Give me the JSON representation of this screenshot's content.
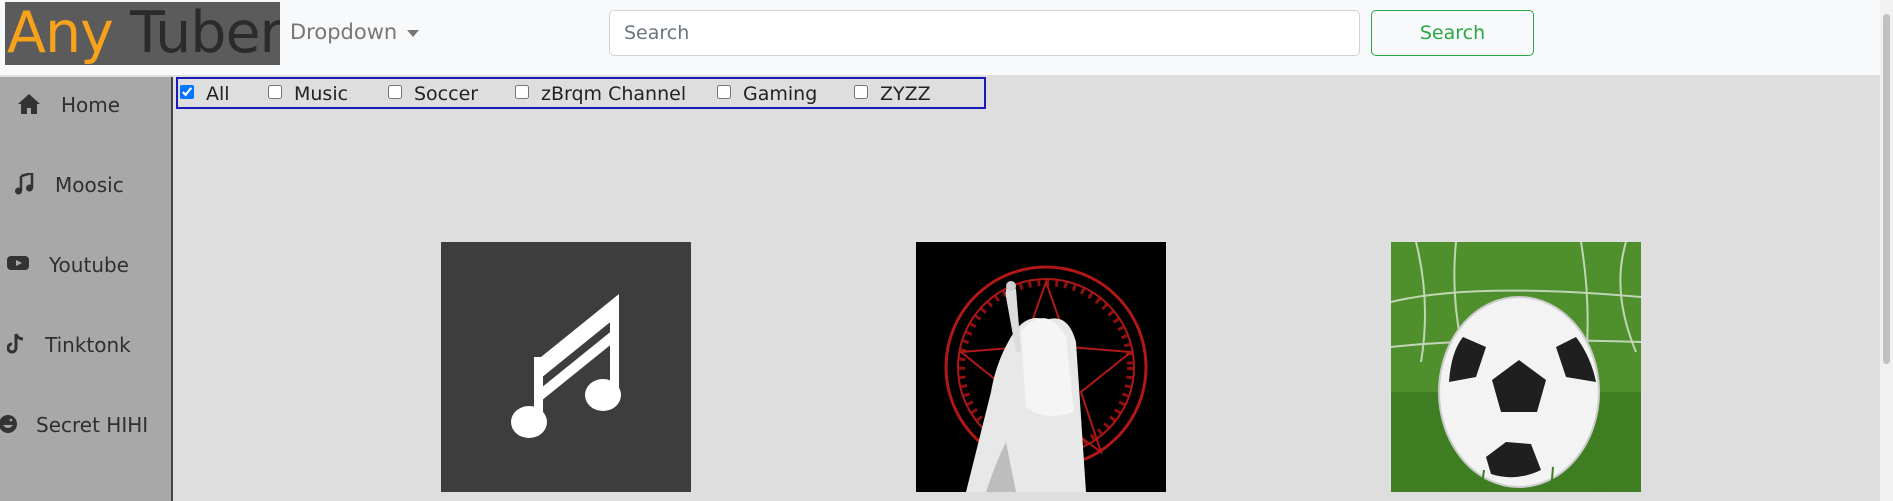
{
  "brand": {
    "part1": "Any",
    "part2": "Tubers",
    "accent": "#f7a21b"
  },
  "navbar": {
    "dropdown_label": "Dropdown",
    "search_placeholder": "Search",
    "search_button": "Search"
  },
  "sidebar": {
    "items": [
      {
        "label": "Home",
        "icon": "home-icon"
      },
      {
        "label": "Moosic",
        "icon": "music-note-icon"
      },
      {
        "label": "Youtube",
        "icon": "youtube-icon"
      },
      {
        "label": "Tinktonk",
        "icon": "tiktok-icon"
      },
      {
        "label": "Secret HIHI",
        "icon": "laughing-face-icon"
      }
    ]
  },
  "filters": [
    {
      "label": "All",
      "checked": true
    },
    {
      "label": "Music",
      "checked": false
    },
    {
      "label": "Soccer",
      "checked": false
    },
    {
      "label": "zBrqm Channel",
      "checked": false
    },
    {
      "label": "Gaming",
      "checked": false
    },
    {
      "label": "ZYZZ",
      "checked": false
    }
  ],
  "tiles": [
    {
      "name": "music-tile",
      "icon": "music-note-icon"
    },
    {
      "name": "occult-figure-tile",
      "icon": "image"
    },
    {
      "name": "soccer-tile",
      "icon": "soccer-ball-image"
    }
  ],
  "colors": {
    "search_green": "#28a745",
    "filter_border": "#1a1ab8",
    "sidebar_bg": "#a8a8a8"
  }
}
